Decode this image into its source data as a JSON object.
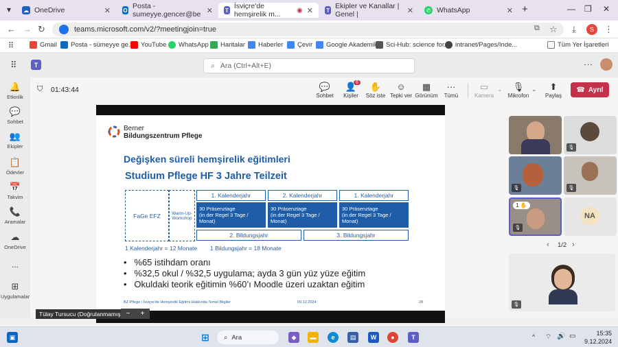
{
  "browser": {
    "tabs": [
      {
        "title": "OneDrive",
        "icon": "cloud",
        "color": "#1e63c4",
        "active": false
      },
      {
        "title": "Posta - sumeyye.gencer@be",
        "icon": "outlook",
        "color": "#0f6cbd",
        "active": false
      },
      {
        "title": "İsviçre'de hemşirelik m...",
        "icon": "teams",
        "color": "#5b5fc7",
        "active": true
      },
      {
        "title": "Ekipler ve Kanallar | Genel | ",
        "icon": "teams",
        "color": "#5b5fc7",
        "active": false
      },
      {
        "title": "WhatsApp",
        "icon": "whatsapp",
        "color": "#25d366",
        "active": false
      }
    ],
    "url": "teams.microsoft.com/v2/?meetingjoin=true",
    "profile_initial": "S",
    "bookmarks": [
      {
        "label": "Gmail",
        "color": "#ea4335"
      },
      {
        "label": "Posta - sümeyye ge...",
        "color": "#0f6cbd"
      },
      {
        "label": "YouTube",
        "color": "#ff0000"
      },
      {
        "label": "WhatsApp",
        "color": "#25d366"
      },
      {
        "label": "Haritalar",
        "color": "#34a853"
      },
      {
        "label": "Haberler",
        "color": "#4285f4"
      },
      {
        "label": "Çevir",
        "color": "#4285f4"
      },
      {
        "label": "Google Akademik",
        "color": "#4285f4"
      },
      {
        "label": "Sci-Hub: science for...",
        "color": "#555555"
      },
      {
        "label": "intranet/Pages/Inde...",
        "color": "#444444"
      }
    ],
    "all_bookmarks": "Tüm Yer İşaretleri"
  },
  "teams": {
    "search_placeholder": "Ara (Ctrl+Alt+E)",
    "rail": [
      {
        "label": "Etkinlik",
        "icon": "bell-icon",
        "glyph": "🔔"
      },
      {
        "label": "Sohbet",
        "icon": "chat-icon",
        "glyph": "💬"
      },
      {
        "label": "Ekipler",
        "icon": "teams-icon",
        "glyph": "👥"
      },
      {
        "label": "Ödevler",
        "icon": "assignment-icon",
        "glyph": "📋"
      },
      {
        "label": "Takvim",
        "icon": "calendar-icon",
        "glyph": "📅"
      },
      {
        "label": "Aramalar",
        "icon": "phone-icon",
        "glyph": "📞"
      },
      {
        "label": "OneDrive",
        "icon": "cloud-icon",
        "glyph": "☁"
      },
      {
        "label": "...",
        "icon": "more-icon",
        "glyph": ""
      },
      {
        "label": "Uygulamalar",
        "icon": "apps-icon",
        "glyph": "⊞"
      }
    ],
    "timer": "01:43:44",
    "toolbar": [
      {
        "label": "Sohbet",
        "icon": "chat-icon",
        "glyph": "💬"
      },
      {
        "label": "Kişiler",
        "icon": "people-icon",
        "glyph": "👤",
        "badge": "6"
      },
      {
        "label": "Söz iste",
        "icon": "hand-icon",
        "glyph": "✋"
      },
      {
        "label": "Tepki ver",
        "icon": "emoji-icon",
        "glyph": "☺"
      },
      {
        "label": "Görünüm",
        "icon": "layout-icon",
        "glyph": "▦"
      },
      {
        "label": "Tümü",
        "icon": "more-icon",
        "glyph": "···"
      },
      {
        "label": "Kamera",
        "icon": "camera-off-icon",
        "glyph": "🎥",
        "disabled": true
      },
      {
        "label": "Mikrofon",
        "icon": "mic-off-icon",
        "glyph": "🎙"
      },
      {
        "label": "Paylaş",
        "icon": "share-icon",
        "glyph": "⬆"
      }
    ],
    "leave_label": "Ayrıl",
    "presenter_name": "Tülay Tursucu (Doğrulanmamış)",
    "pagination": "1/2",
    "raised_hand_count": "1",
    "participant_initials": "NA"
  },
  "slide": {
    "logo_line1": "Berner",
    "logo_line2": "Bildungszentrum Pflege",
    "title": "Değişken süreli hemşirelik eğitimleri",
    "subtitle": "Studium Pflege HF 3 Jahre Teilzeit",
    "years": [
      "1. Kalenderjahr",
      "2. Kalenderjahr",
      "1. Kalenderjahr"
    ],
    "fage": "FaGe EFZ",
    "warmup": "Warm-Up-Workshop",
    "blocks": [
      "30 Präsenztage\n(in der Regel 3 Tage /\nMonat)",
      "30 Präsenztage\n(in der Regel 3 Tage /\nMonat)",
      "30 Präsenztage\n(in der Regel 3 Tage /\nMonat)"
    ],
    "bildungsjahre": [
      "2. Bildungsjahr",
      "3. Bildungsjahr"
    ],
    "note1": "1 Kalenderjahr = 12 Monate",
    "note2": "1 Bildungsjahr = 18 Monate",
    "bullets": [
      "%65 istihdam oranı",
      "%32,5 okul / %32,5 uygulama; ayda 3 gün yüz yüze eğitim",
      "Okuldaki teorik eğitimin %60’ı Moodle üzeri uzaktan eğitim"
    ],
    "footer_left": "BZ Pflege / İsviçre'de Hemşirelik Eğitimi Hakkında Temel Bilgiler",
    "footer_date": "09.12.2024",
    "footer_page": "28"
  },
  "taskbar": {
    "search_label": "Ara",
    "time": "15:35",
    "date": "9.12.2024"
  },
  "colors": {
    "teams_purple": "#5b5fc7",
    "slide_blue": "#1f5da8",
    "leave_red": "#c4314b"
  }
}
